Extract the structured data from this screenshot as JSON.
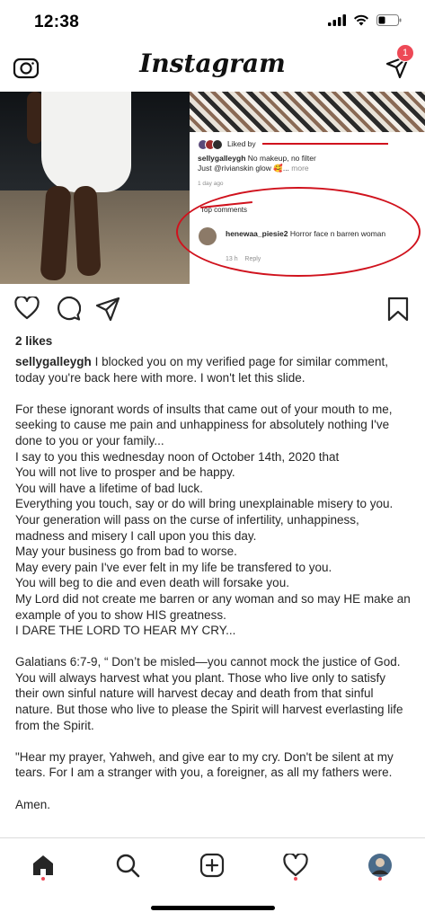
{
  "status": {
    "time": "12:38"
  },
  "header": {
    "logo": "Instagram",
    "dm_badge": "1"
  },
  "post_image": {
    "liked_prefix": "Liked by",
    "caption_user": "sellygalleygh",
    "caption_line1": "No makeup, no filter",
    "caption_line2_prefix": "Just",
    "caption_mention": "@rivianskin",
    "caption_line2_suffix": "glow 🥰...",
    "caption_more": "more",
    "timestamp": "1 day ago",
    "top_comments": "Top comments",
    "comment_user": "henewaa_piesie2",
    "comment_text": "Horror face n barren woman",
    "comment_time": "13 h",
    "comment_reply": "Reply"
  },
  "actions": {
    "like_icon": "heart-icon",
    "comment_icon": "comment-icon",
    "share_icon": "share-icon",
    "save_icon": "bookmark-icon"
  },
  "likes": "2 likes",
  "caption": {
    "username": "sellygalleygh",
    "intro": "I blocked you on my verified page for similar comment, today you're back here with more. I won't let this slide.",
    "paragraph1": [
      "For these ignorant words of insults that came out of your mouth to me, seeking to cause me pain and unhappiness for absolutely nothing I've done to you or your family...",
      "I say to you this wednesday noon of October 14th, 2020 that",
      "You will not live to prosper and be happy.",
      "You will have a lifetime of bad luck.",
      "Everything you touch, say or do will bring unexplainable misery to you.",
      "Your generation will pass on the curse of infertility, unhappiness, madness and misery I call upon you this day.",
      "May your business go from bad to worse.",
      "May every pain I've ever felt in my life be transfered to you.",
      "You will beg to die and even death will forsake you.",
      "My Lord did not create me barren or any woman and so may HE make an example of you to show HIS greatness.",
      "I DARE THE LORD TO HEAR MY CRY..."
    ],
    "paragraph2": "Galatians 6:7-9, “ Don’t be misled—you cannot mock the justice of God. You will always harvest what you plant. Those who live only to satisfy their own sinful nature will harvest decay and death from that sinful nature. But those who live to please the Spirit will harvest everlasting life from the Spirit.",
    "paragraph3": "\"Hear my prayer, Yahweh, and give ear to my cry. Don't be silent at my tears. For I am a stranger with you, a foreigner, as all my fathers were.",
    "paragraph4": "Amen."
  },
  "bottom_nav": {
    "items": [
      "home-icon",
      "search-icon",
      "new-post-icon",
      "activity-icon",
      "profile-avatar"
    ]
  },
  "colors": {
    "accent_red": "#ed4956",
    "annotation_red": "#d0121d",
    "text": "#262626",
    "gray": "#8e8e8e"
  }
}
